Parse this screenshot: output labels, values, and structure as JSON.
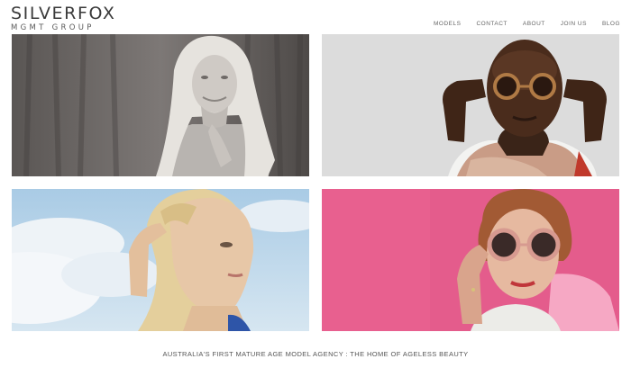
{
  "logo": {
    "main": "SILVERFOX",
    "sub": "MGMT GROUP"
  },
  "nav": {
    "items": [
      {
        "label": "MODELS"
      },
      {
        "label": "CONTACT"
      },
      {
        "label": "ABOUT"
      },
      {
        "label": "JOIN US"
      },
      {
        "label": "BLOG"
      }
    ]
  },
  "tagline": "AUSTRALIA'S FIRST MATURE AGE MODEL AGENCY : THE HOME OF AGELESS BEAUTY"
}
